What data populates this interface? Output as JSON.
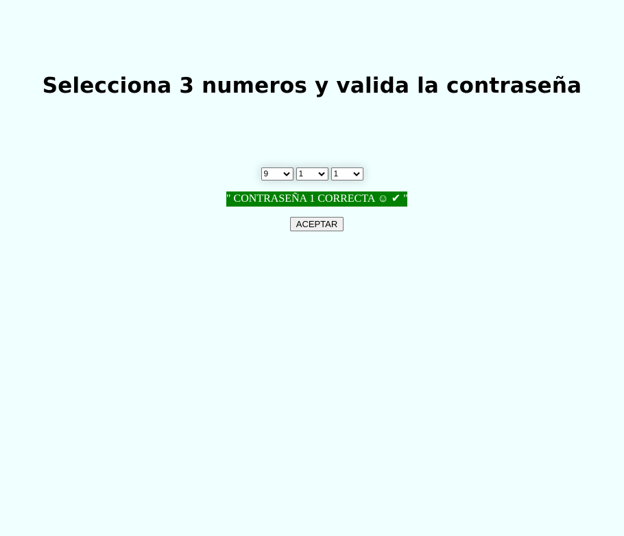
{
  "page": {
    "title": "Selecciona 3 numeros y valida la contraseña",
    "background_color": "#f0ffff"
  },
  "selects": [
    {
      "value": "9"
    },
    {
      "value": "1"
    },
    {
      "value": "1"
    }
  ],
  "status": {
    "text": "\" CONTRASEÑA 1 CORRECTA ☺ ✔ \"",
    "background_color": "#008000",
    "text_color": "#ffffff"
  },
  "button": {
    "label": "ACEPTAR"
  }
}
